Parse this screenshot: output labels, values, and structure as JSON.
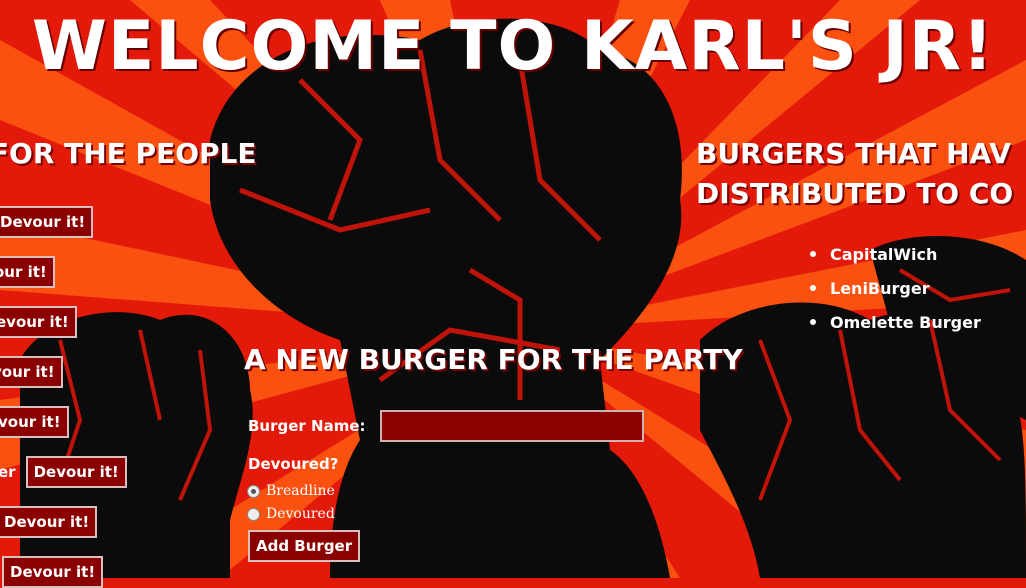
{
  "title": "WELCOME TO KARL'S JR!",
  "left_heading": "S FOR THE PEOPLE",
  "right_heading_line1": "BURGERS THAT HAV",
  "right_heading_line2": "DISTRIBUTED TO CO",
  "devour_rows": [
    {
      "prefix": "",
      "label": "Devour it!"
    },
    {
      "prefix": "",
      "label": "our it!"
    },
    {
      "prefix": "",
      "label": "evour it!"
    },
    {
      "prefix": "",
      "label": "vour it!"
    },
    {
      "prefix": "",
      "label": "vour it!"
    },
    {
      "prefix": "er",
      "label": "Devour it!"
    },
    {
      "prefix": "",
      "label": "Devour it!"
    },
    {
      "prefix": "",
      "label": "Devour it!"
    }
  ],
  "eaten_burgers": [
    "CapitalWich",
    "LeniBurger",
    "Omelette Burger"
  ],
  "form": {
    "heading": "A NEW BURGER FOR THE PARTY",
    "name_label": "Burger Name:",
    "name_value": "",
    "devoured_label": "Devoured?",
    "radio_options": [
      {
        "label": "Breadline",
        "checked": true
      },
      {
        "label": "Devoured",
        "checked": false
      }
    ],
    "submit_label": "Add Burger"
  },
  "colors": {
    "background": "#e31a0a",
    "ray": "#ff5a12",
    "fist": "#0b0b0b",
    "button": "#8b0000"
  }
}
